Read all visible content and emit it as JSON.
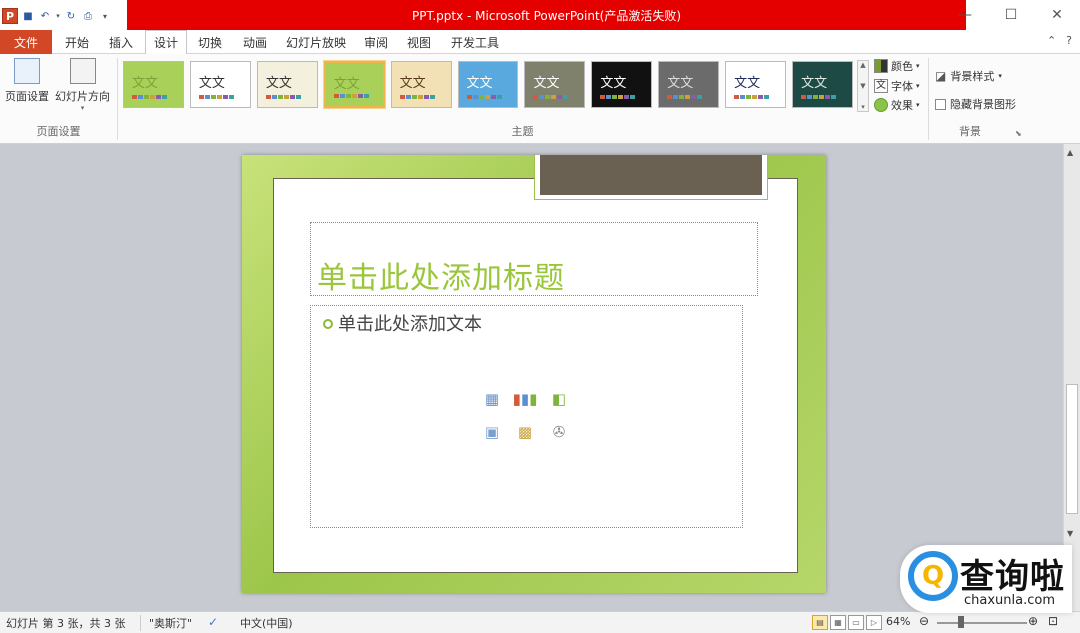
{
  "window": {
    "title": "PPT.pptx - Microsoft PowerPoint(产品激活失败)",
    "controls": [
      "minimize-icon",
      "maximize-icon",
      "close-icon"
    ]
  },
  "quick_access": [
    "powerpoint-logo-icon",
    "save-icon",
    "undo-icon",
    "redo-icon",
    "print-preview-icon",
    "customize-icon"
  ],
  "tabs": {
    "file": "文件",
    "items": [
      "开始",
      "插入",
      "设计",
      "切换",
      "动画",
      "幻灯片放映",
      "审阅",
      "视图",
      "开发工具"
    ],
    "active": "设计"
  },
  "ribbon": {
    "page_setup": {
      "btn_page_setup": "页面设置",
      "btn_orientation": "幻灯片方向",
      "group_label": "页面设置"
    },
    "themes": {
      "group_label": "主题",
      "sample_text": "文文",
      "items": [
        {
          "bg": "#a9d15a",
          "fg": "#7aa337"
        },
        {
          "bg": "#ffffff",
          "fg": "#333333"
        },
        {
          "bg": "#f3f0dd",
          "fg": "#333333"
        },
        {
          "bg": "#a9d15a",
          "fg": "#7aa337"
        },
        {
          "bg": "#f2e1b4",
          "fg": "#5a3b1f"
        },
        {
          "bg": "#59a8de",
          "fg": "#ffffff"
        },
        {
          "bg": "#7f816d",
          "fg": "#ffffff"
        },
        {
          "bg": "#111111",
          "fg": "#ffffff"
        },
        {
          "bg": "#6b6b6b",
          "fg": "#dddddd"
        },
        {
          "bg": "#ffffff",
          "fg": "#1f2a5a"
        },
        {
          "bg": "#1e4a45",
          "fg": "#dfe9e4"
        }
      ],
      "options": {
        "colors": "颜色",
        "fonts": "字体",
        "effects": "效果"
      }
    },
    "background": {
      "styles": "背景样式",
      "hide_graphics": "隐藏背景图形",
      "group_label": "背景"
    }
  },
  "slide": {
    "title_placeholder": "单击此处添加标题",
    "body_placeholder": "单击此处添加文本",
    "content_icons": [
      "table-icon",
      "chart-icon",
      "smartart-icon",
      "picture-icon",
      "clipart-icon",
      "media-icon"
    ]
  },
  "status": {
    "slide_info": "幻灯片 第 3 张，共 3 张",
    "theme": "\"奥斯汀\"",
    "language": "中文(中国)",
    "zoom": "64%"
  },
  "watermark": {
    "text": "查询啦",
    "url": "chaxunla.com"
  }
}
